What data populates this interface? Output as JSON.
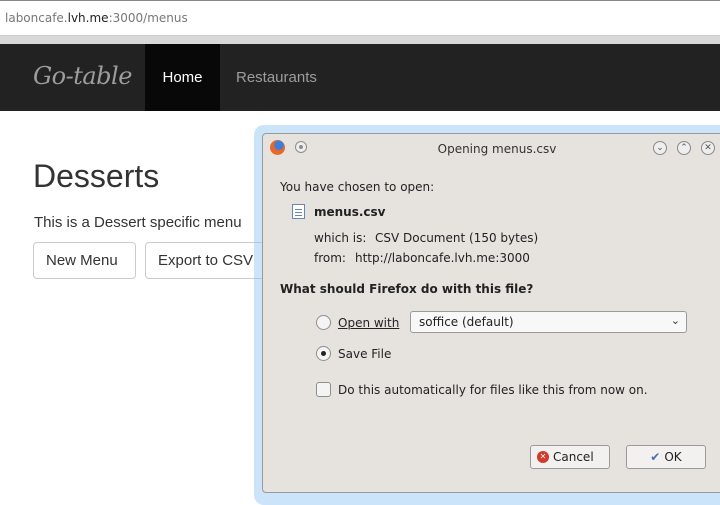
{
  "browser": {
    "url_prefix": "laboncafe.",
    "url_domain": "lvh.me",
    "url_suffix": ":3000/menus"
  },
  "navbar": {
    "brand": "Go-table",
    "items": [
      "Home",
      "Restaurants"
    ]
  },
  "page": {
    "title": "Desserts",
    "description": "This is a Dessert specific menu",
    "buttons": [
      "New Menu",
      "Export to CSV"
    ]
  },
  "dialog": {
    "title": "Opening menus.csv",
    "intro": "You have chosen to open:",
    "filename": "menus.csv",
    "which_is_label": "which is:",
    "which_is_value": "CSV Document (150 bytes)",
    "from_label": "from:",
    "from_value": "http://laboncafe.lvh.me:3000",
    "question": "What should Firefox do with this file?",
    "open_with_label": "Open with",
    "open_with_selected": "soffice (default)",
    "save_file_label": "Save File",
    "auto_label": "Do this automatically for files like this from now on.",
    "cancel_label": "Cancel",
    "ok_label": "OK",
    "selected_action": "Save File"
  },
  "colors": {
    "navbar_bg": "#222222",
    "nav_active_bg": "#080808",
    "dialog_bg": "#e6e3df",
    "dialog_glow": "#8cc3f5"
  }
}
